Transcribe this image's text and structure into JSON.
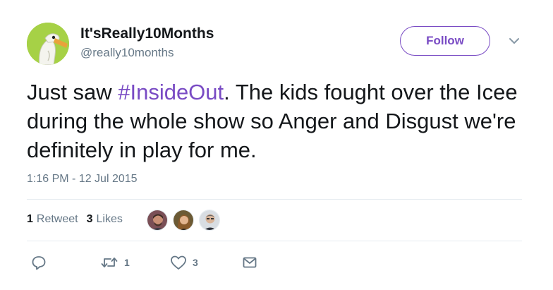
{
  "user": {
    "display_name": "It'sReally10Months",
    "handle": "@really10months",
    "avatar_icon": "pelican-cartoon-avatar"
  },
  "follow_label": "Follow",
  "tweet": {
    "text_before": "Just saw ",
    "hashtag": "#InsideOut",
    "text_after": ". The kids fought over the Icee during the whole show so Anger and Disgust we're definitely in play for me.",
    "timestamp": "1:16 PM - 12 Jul 2015"
  },
  "stats": {
    "retweets_count": "1",
    "retweets_label": "Retweet",
    "likes_count": "3",
    "likes_label": "Likes"
  },
  "actions": {
    "reply_icon": "reply-icon",
    "retweet_icon": "retweet-icon",
    "retweet_count": "1",
    "like_icon": "heart-icon",
    "like_count": "3",
    "message_icon": "envelope-icon"
  },
  "colors": {
    "accent": "#794bc4",
    "text": "#14171a",
    "secondary": "#657786",
    "divider": "#e6ecf0"
  }
}
